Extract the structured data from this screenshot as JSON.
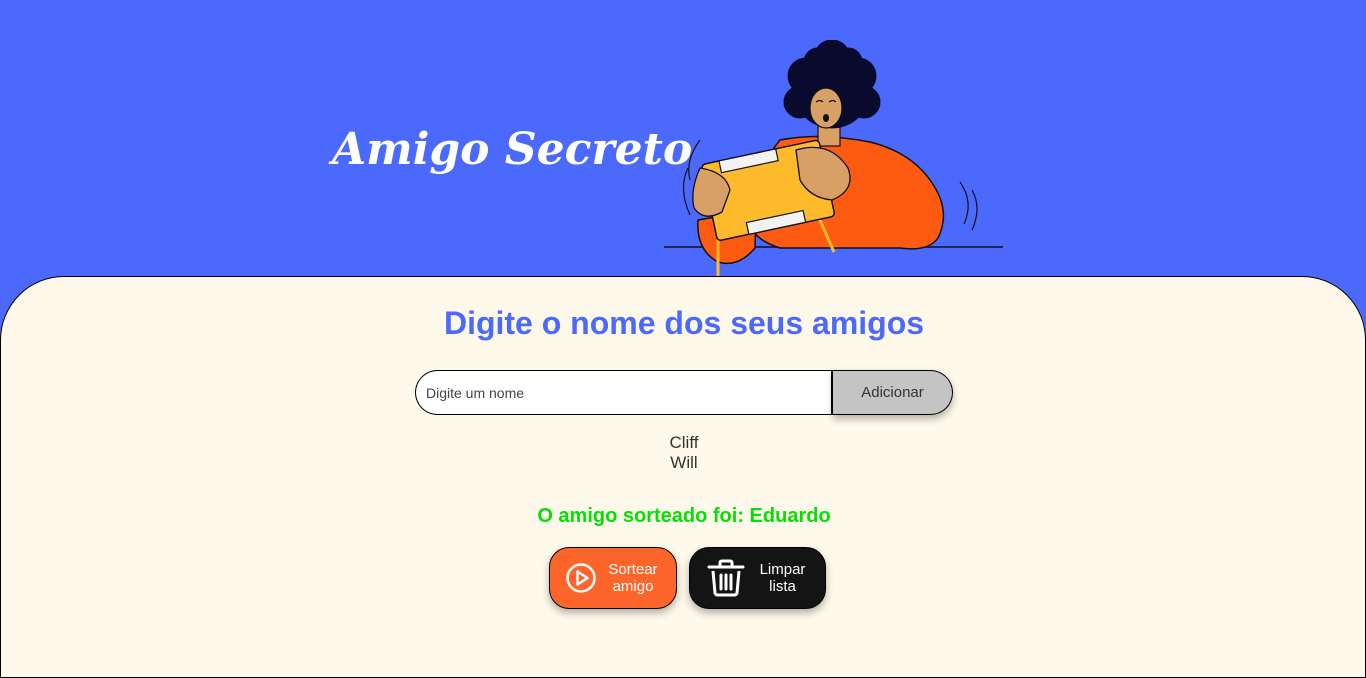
{
  "header": {
    "title": "Amigo Secreto",
    "illustration": "person-holding-game-console"
  },
  "main": {
    "subtitle": "Digite o nome dos seus amigos",
    "input": {
      "placeholder": "Digite um nome",
      "value": ""
    },
    "add_button_label": "Adicionar",
    "friends": [
      "Cliff",
      "Will"
    ],
    "result_text": "O amigo sorteado foi: Eduardo",
    "draw_button": {
      "label_line1": "Sortear",
      "label_line2": "amigo",
      "icon": "play-circle-icon"
    },
    "clear_button": {
      "label_line1": "Limpar",
      "label_line2": "lista",
      "icon": "trash-icon"
    }
  },
  "colors": {
    "header_bg": "#4B69FD",
    "main_bg": "#FFF9EB",
    "accent_blue": "#4B69FD",
    "result_green": "#05DF05",
    "draw_orange": "#FE652B",
    "clear_black": "#141414",
    "add_gray": "#C4C4C4"
  }
}
